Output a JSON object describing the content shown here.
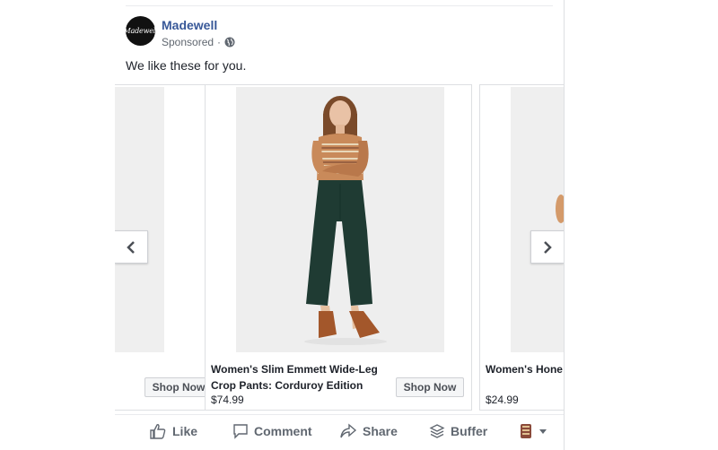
{
  "post": {
    "page_name": "Madewell",
    "avatar_text": "Madewell",
    "sponsored": "Sponsored",
    "separator": "·",
    "text": "We like these for you."
  },
  "carousel": {
    "cards": [
      {
        "caption": "",
        "price": "",
        "cta": "Shop Now"
      },
      {
        "caption": "Women's Slim Emmett Wide-Leg Crop Pants: Corduroy Edition",
        "price": "$74.99",
        "cta": "Shop Now"
      },
      {
        "caption": "Women's Hone in Kasson Strip",
        "price": "$24.99",
        "cta": ""
      }
    ]
  },
  "actions": {
    "like": "Like",
    "comment": "Comment",
    "share": "Share",
    "buffer": "Buffer"
  },
  "colors": {
    "brand_link": "#385898",
    "pants": "#1f3b33",
    "sweater": "#c98a5a",
    "boots": "#a3572b"
  },
  "icons": [
    "globe-icon",
    "chevron-left-icon",
    "chevron-right-icon",
    "like-icon",
    "comment-icon",
    "share-icon",
    "buffer-icon",
    "caret-down-icon"
  ]
}
